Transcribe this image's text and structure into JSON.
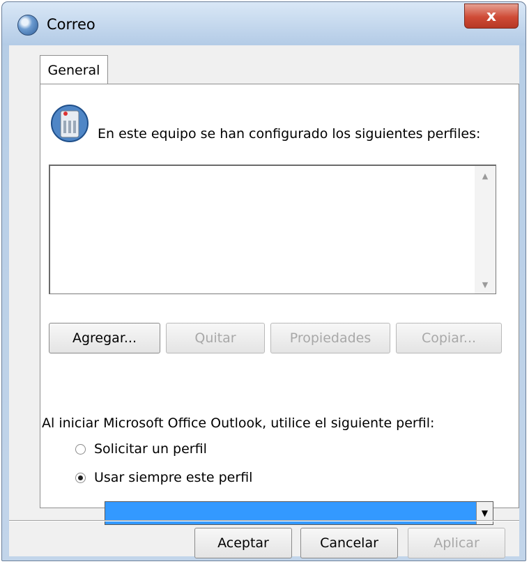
{
  "window": {
    "title": "Correo",
    "close_label": "x"
  },
  "tabs": [
    {
      "label": "General"
    }
  ],
  "panel": {
    "intro": "En este equipo se han configurado los siguientes perfiles:",
    "buttons": {
      "add": "Agregar...",
      "remove": "Quitar",
      "properties": "Propiedades",
      "copy": "Copiar..."
    },
    "startup_label": "Al iniciar Microsoft Office Outlook, utilice el siguiente perfil:",
    "radio_prompt": "Solicitar un perfil",
    "radio_always": "Usar siempre este perfil",
    "selected_profile": ""
  },
  "footer": {
    "ok": "Aceptar",
    "cancel": "Cancelar",
    "apply": "Aplicar"
  },
  "colors": {
    "selection": "#3399ff",
    "close": "#cf4b36"
  }
}
